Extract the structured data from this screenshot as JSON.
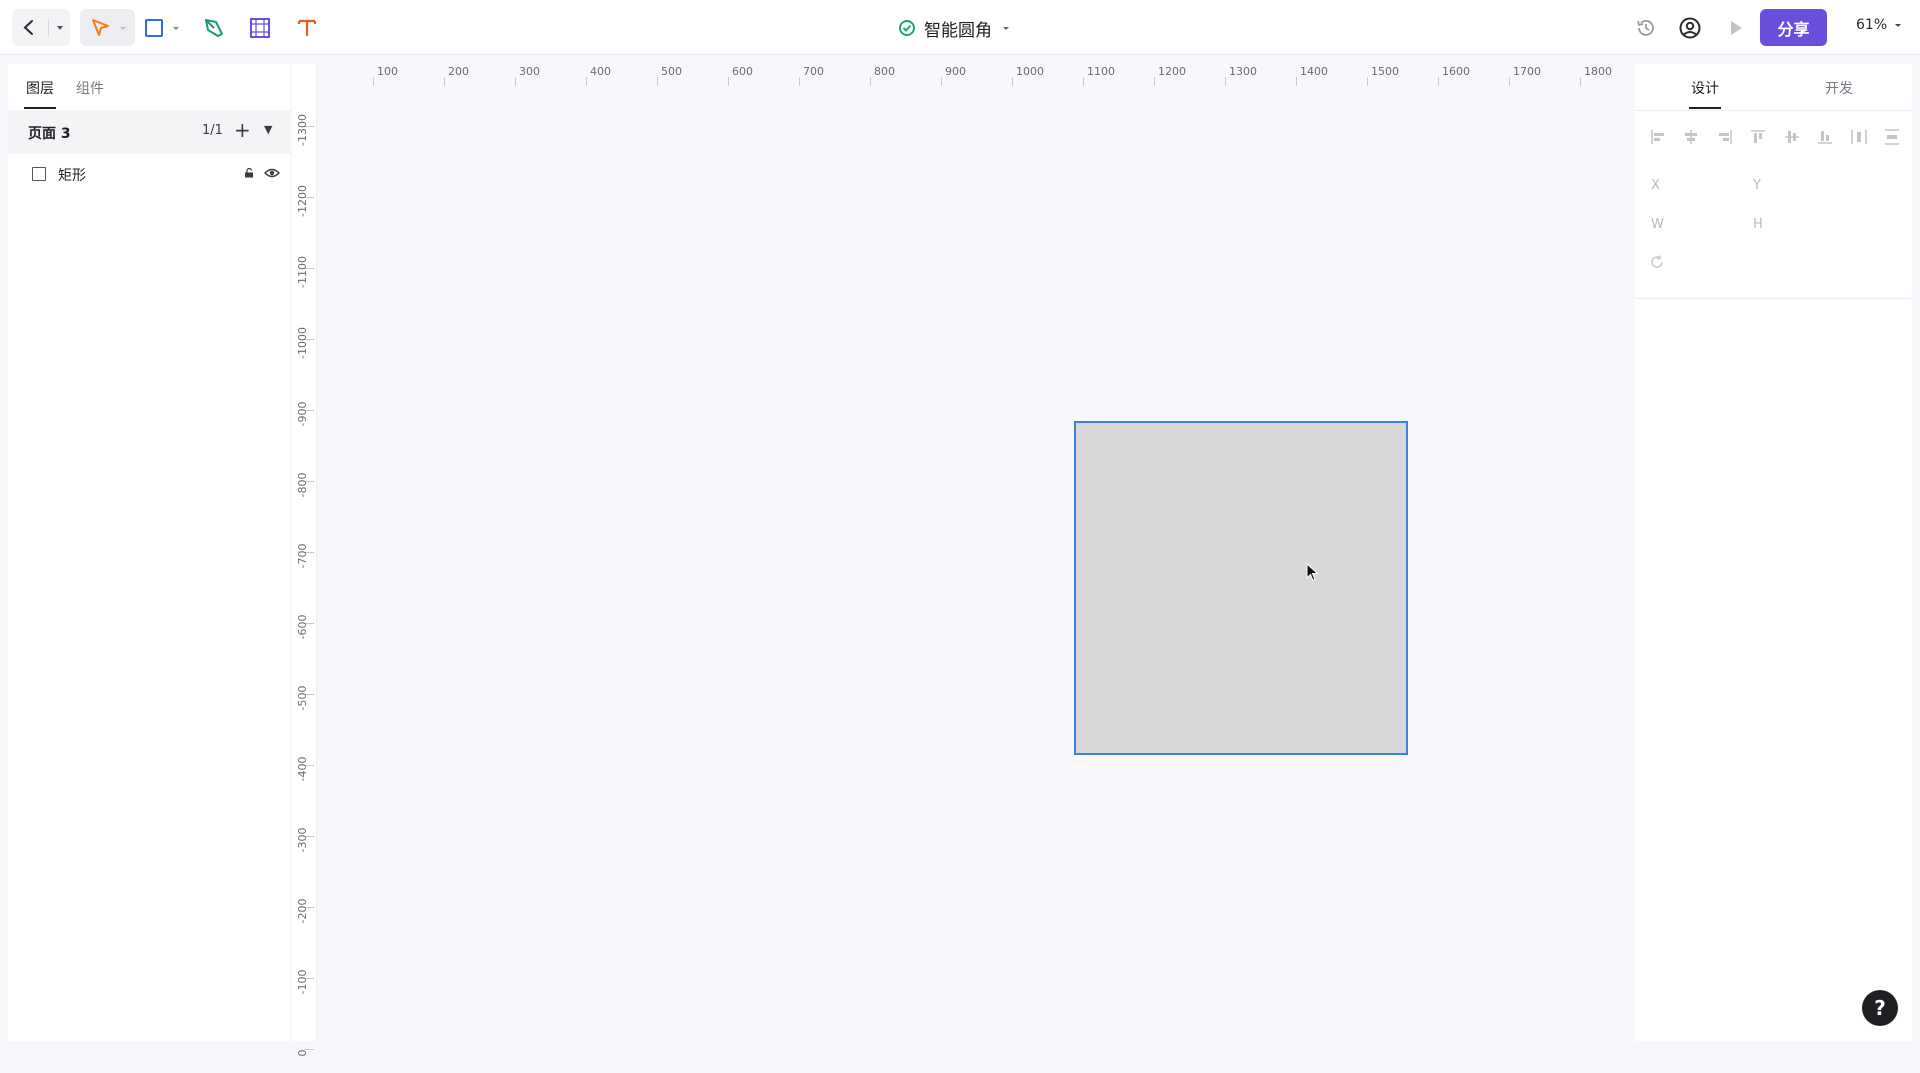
{
  "toolbar": {
    "doc_title": "智能圆角",
    "share_label": "分享",
    "zoom": "61%"
  },
  "left_panel": {
    "tabs": [
      "图层",
      "组件"
    ],
    "page": {
      "name": "页面 3",
      "count": "1/1"
    },
    "layers": [
      {
        "name": "矩形"
      }
    ]
  },
  "ruler": {
    "top": [
      "100",
      "200",
      "300",
      "400",
      "500",
      "600",
      "700",
      "800",
      "900",
      "1000",
      "1100",
      "1200",
      "1300",
      "1400",
      "1500",
      "1600",
      "1700",
      "1800"
    ],
    "left": [
      "-1300",
      "-1200",
      "-1100",
      "-1000",
      "-900",
      "-800",
      "-700",
      "-600",
      "-500",
      "-400",
      "-300",
      "-200",
      "-100",
      "0"
    ]
  },
  "right_panel": {
    "tabs": [
      "设计",
      "开发"
    ],
    "props": {
      "x": "X",
      "y": "Y",
      "w": "W",
      "h": "H"
    }
  },
  "help": {
    "label": "?"
  },
  "colors": {
    "accent": "#6a4fdc",
    "selection": "#3f7fe0",
    "rect_fill": "#d7d7da"
  }
}
